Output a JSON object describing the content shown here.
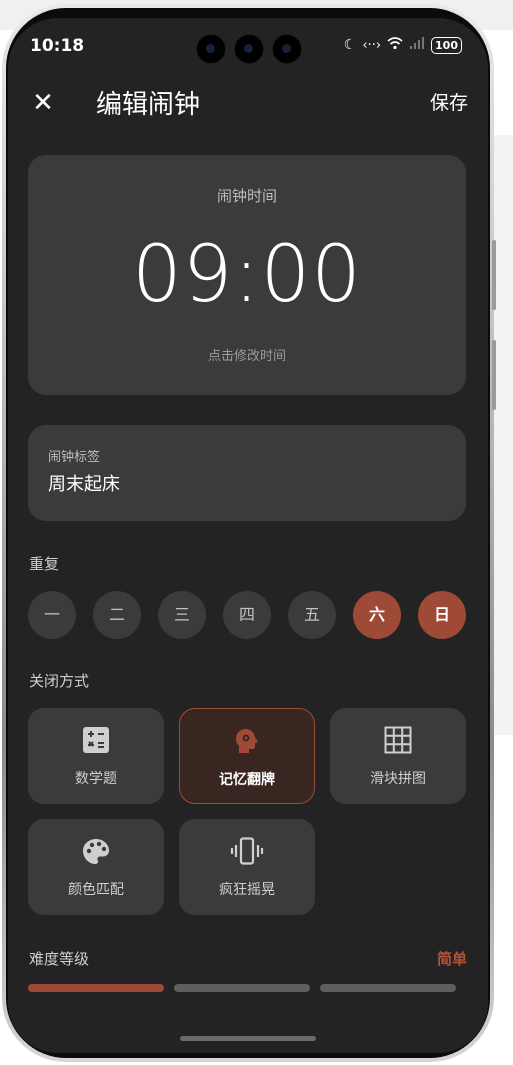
{
  "status": {
    "time": "10:18",
    "battery": "100"
  },
  "header": {
    "title": "编辑闹钟",
    "save": "保存"
  },
  "time_card": {
    "label": "闹钟时间",
    "time": "09:00",
    "hint": "点击修改时间"
  },
  "label_card": {
    "caption": "闹钟标签",
    "value": "周末起床"
  },
  "repeat": {
    "title": "重复",
    "days": [
      {
        "label": "一",
        "selected": false
      },
      {
        "label": "二",
        "selected": false
      },
      {
        "label": "三",
        "selected": false
      },
      {
        "label": "四",
        "selected": false
      },
      {
        "label": "五",
        "selected": false
      },
      {
        "label": "六",
        "selected": true
      },
      {
        "label": "日",
        "selected": true
      }
    ]
  },
  "dismiss": {
    "title": "关闭方式",
    "methods": [
      {
        "label": "数学题",
        "icon": "calculator-icon",
        "selected": false
      },
      {
        "label": "记忆翻牌",
        "icon": "brain-head-icon",
        "selected": true
      },
      {
        "label": "滑块拼图",
        "icon": "grid-icon",
        "selected": false
      },
      {
        "label": "颜色匹配",
        "icon": "palette-icon",
        "selected": false
      },
      {
        "label": "疯狂摇晃",
        "icon": "vibration-icon",
        "selected": false
      }
    ]
  },
  "difficulty": {
    "title": "难度等级",
    "value": "简单",
    "level": 1,
    "levels": 3
  },
  "colors": {
    "accent": "#9e4a37",
    "card": "#3b3b3b",
    "background": "#232323"
  }
}
